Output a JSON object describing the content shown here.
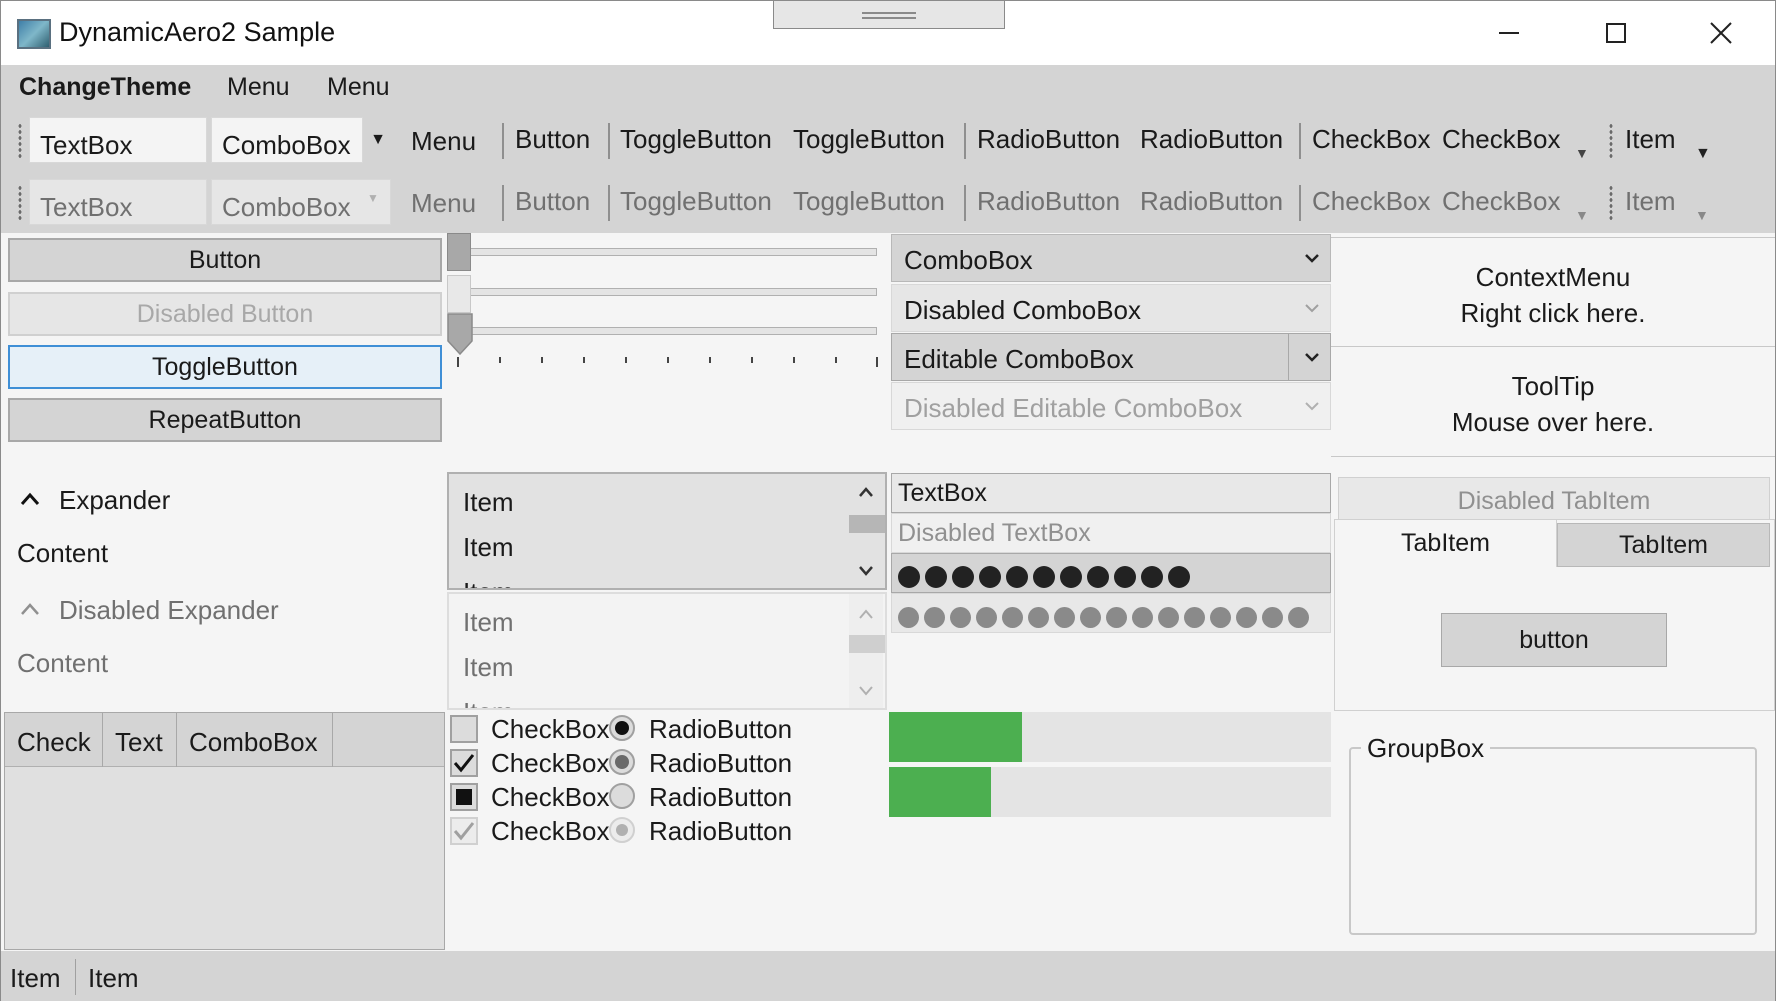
{
  "window": {
    "title": "DynamicAero2 Sample"
  },
  "menu": {
    "items": [
      "ChangeTheme",
      "Menu",
      "Menu"
    ]
  },
  "toolbar": {
    "textbox": "TextBox",
    "combobox": "ComboBox",
    "menu": "Menu",
    "button": "Button",
    "toggle1": "ToggleButton",
    "toggle2": "ToggleButton",
    "radio1": "RadioButton",
    "radio2": "RadioButton",
    "check1": "CheckBox",
    "check2": "CheckBox",
    "item": "Item"
  },
  "buttons": {
    "button": "Button",
    "disabled": "Disabled Button",
    "toggle": "ToggleButton",
    "repeat": "RepeatButton"
  },
  "combos": {
    "c1": "ComboBox",
    "c2": "Disabled ComboBox",
    "c3": "Editable ComboBox",
    "c4": "Disabled Editable ComboBox"
  },
  "context": {
    "line1": "ContextMenu",
    "line2": "Right click here."
  },
  "tooltip": {
    "line1": "ToolTip",
    "line2": "Mouse over here."
  },
  "expander": {
    "header": "Expander",
    "content": "Content",
    "disabled_header": "Disabled Expander",
    "disabled_content": "Content"
  },
  "listbox": {
    "items": [
      "Item",
      "Item",
      "Item"
    ]
  },
  "listbox2": {
    "items": [
      "Item",
      "Item",
      "Item"
    ]
  },
  "textboxes": {
    "t1": "TextBox",
    "t2": "Disabled TextBox",
    "p1_count": 11,
    "p2_count": 16
  },
  "tabs": {
    "disabled": "Disabled TabItem",
    "tab1": "TabItem",
    "tab2": "TabItem",
    "content_button": "button"
  },
  "grid": {
    "headers": [
      "Check",
      "Text",
      "ComboBox"
    ]
  },
  "checks": [
    {
      "check": "CheckBox",
      "radio": "RadioButton",
      "state": "unchecked",
      "radio_state": "checked"
    },
    {
      "check": "CheckBox",
      "radio": "RadioButton",
      "state": "checked",
      "radio_state": "checked-gray"
    },
    {
      "check": "CheckBox",
      "radio": "RadioButton",
      "state": "indeterminate",
      "radio_state": "unchecked"
    },
    {
      "check": "CheckBox",
      "radio": "RadioButton",
      "state": "checked-disabled",
      "radio_state": "disabled"
    }
  ],
  "progress": {
    "p1": 0.3,
    "p2": 0.23
  },
  "groupbox": {
    "header": "GroupBox"
  },
  "statusbar": {
    "items": [
      "Item",
      "Item"
    ]
  },
  "colors": {
    "accent": "#3f8fd6",
    "progress": "#4caf50",
    "chrome": "#d4d4d4"
  }
}
